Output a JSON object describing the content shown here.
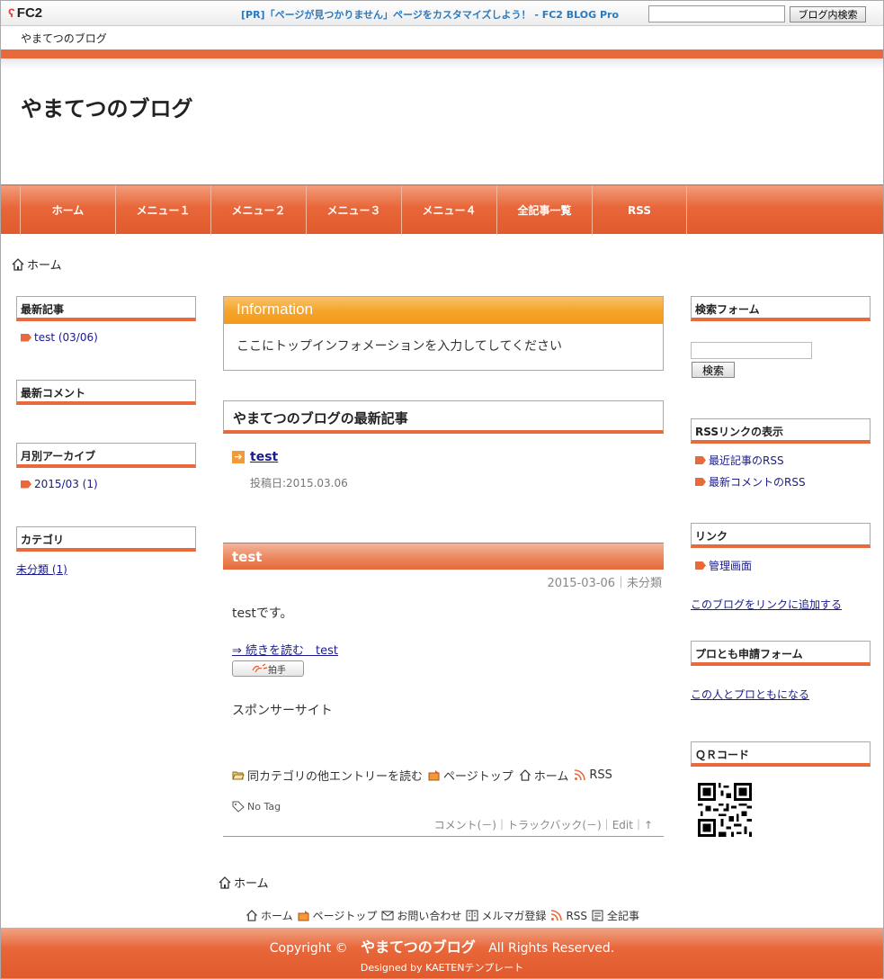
{
  "fc2bar": {
    "logo": "FC2",
    "pr_text": "[PR]「ページが見つかりません」ページをカスタマイズしよう！ - FC2 BLOG Pro",
    "search_button": "ブログ内検索",
    "blog_name": "やまてつのブログ"
  },
  "header": {
    "title": "やまてつのブログ"
  },
  "nav": [
    "ホーム",
    "メニュー１",
    "メニュー２",
    "メニュー３",
    "メニュー４",
    "全記事一覧",
    "RSS"
  ],
  "breadcrumb": "ホーム",
  "left": {
    "recent_title": "最新記事",
    "recent_item": "test (03/06)",
    "comments_title": "最新コメント",
    "archive_title": "月別アーカイブ",
    "archive_item": "2015/03 (1)",
    "category_title": "カテゴリ",
    "category_item": "未分類 (1)"
  },
  "main": {
    "info_title": "Information",
    "info_text": "ここにトップインフォメーションを入力してしてください",
    "latest_title": "やまてつのブログの最新記事",
    "latest_link": "test",
    "latest_date": "投稿日:2015.03.06",
    "entry_title": "test",
    "entry_meta": "2015-03-06｜未分類",
    "entry_body": "testです。",
    "readmore": "⇒ 続きを読む　test",
    "clap": "拍手",
    "sponsor": "スポンサーサイト",
    "entry_nav": [
      "同カテゴリの他エントリーを読む",
      "ページトップ",
      "ホーム",
      "RSS"
    ],
    "no_tag": "No Tag",
    "entry_foot": "コメント(－)｜トラックバック(－)｜Edit｜↑"
  },
  "breadcrumb_bottom": "ホーム",
  "footnav": [
    "ホーム",
    "ページトップ",
    "お問い合わせ",
    "メルマガ登録",
    "RSS",
    "全記事"
  ],
  "right": {
    "search_title": "検索フォーム",
    "search_button": "検索",
    "rss_title": "RSSリンクの表示",
    "rss_items": [
      "最近記事のRSS",
      "最新コメントのRSS"
    ],
    "links_title": "リンク",
    "links_item": "管理画面",
    "add_link": "このブログをリンクに追加する",
    "pro_title": "プロとも申請フォーム",
    "pro_link": "この人とプロともになる",
    "qr_title": "ＱＲコード"
  },
  "footer": {
    "copy_prefix": "Copyright ©",
    "copy_name": "やまてつのブログ",
    "copy_suffix": "All Rights Reserved.",
    "designed": "Designed by KAETENテンプレート"
  },
  "colors": {
    "accent": "#e86a3c",
    "info": "#f5a52c",
    "link": "#1a1a8c"
  }
}
